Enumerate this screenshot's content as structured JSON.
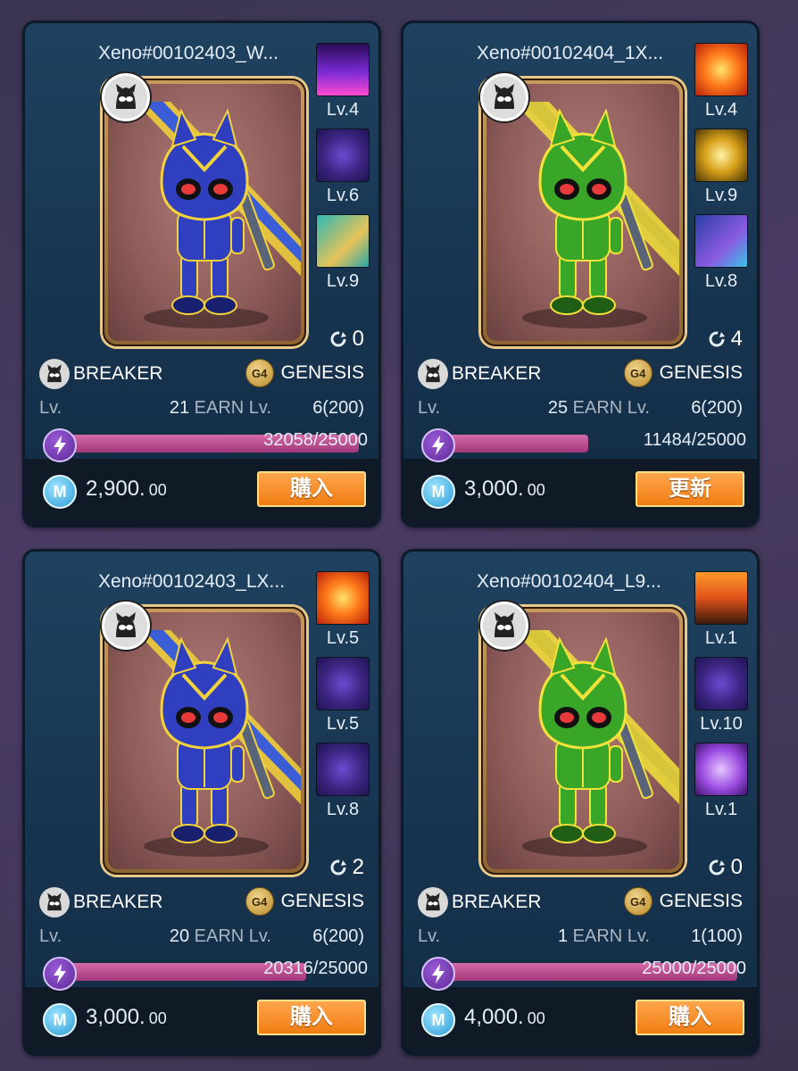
{
  "cards": [
    {
      "name": "Xeno#00102403_W...",
      "skills": [
        {
          "lv": "Lv.4",
          "icon": "neon-orb-skill-icon"
        },
        {
          "lv": "Lv.6",
          "icon": "target-skill-icon"
        },
        {
          "lv": "Lv.9",
          "icon": "boot-skill-icon"
        }
      ],
      "repair": "0",
      "class": "BREAKER",
      "gen_badge": "G4",
      "genesis": "GENESIS",
      "lv_label": "Lv.",
      "lv": "21",
      "earn_label": "EARN Lv.",
      "earn": "6(200)",
      "energy": "32058/25000",
      "energy_fraction": 1.0,
      "coin": "M",
      "price": "2,900.",
      "price_dec": "00",
      "button": "購入",
      "color": "blue"
    },
    {
      "name": "Xeno#00102404_1X...",
      "skills": [
        {
          "lv": "Lv.4",
          "icon": "fire-skill-icon"
        },
        {
          "lv": "Lv.9",
          "icon": "star-burst-skill-icon"
        },
        {
          "lv": "Lv.8",
          "icon": "shield-skill-icon"
        }
      ],
      "repair": "4",
      "class": "BREAKER",
      "gen_badge": "G4",
      "genesis": "GENESIS",
      "lv_label": "Lv.",
      "lv": "25",
      "earn_label": "EARN Lv.",
      "earn": "6(200)",
      "energy": "11484/25000",
      "energy_fraction": 0.46,
      "coin": "M",
      "price": "3,000.",
      "price_dec": "00",
      "button": "更新",
      "color": "green"
    },
    {
      "name": "Xeno#00102403_LX...",
      "skills": [
        {
          "lv": "Lv.5",
          "icon": "fire-skill-icon"
        },
        {
          "lv": "Lv.5",
          "icon": "target-skill-icon"
        },
        {
          "lv": "Lv.8",
          "icon": "target-skill-icon"
        }
      ],
      "repair": "2",
      "class": "BREAKER",
      "gen_badge": "G4",
      "genesis": "GENESIS",
      "lv_label": "Lv.",
      "lv": "20",
      "earn_label": "EARN Lv.",
      "earn": "6(200)",
      "energy": "20316/25000",
      "energy_fraction": 0.81,
      "coin": "M",
      "price": "3,000.",
      "price_dec": "00",
      "button": "購入",
      "color": "blue"
    },
    {
      "name": "Xeno#00102404_L9...",
      "skills": [
        {
          "lv": "Lv.1",
          "icon": "flame-warrior-skill-icon"
        },
        {
          "lv": "Lv.10",
          "icon": "target-skill-icon"
        },
        {
          "lv": "Lv.1",
          "icon": "ghost-skill-icon"
        }
      ],
      "repair": "0",
      "class": "BREAKER",
      "gen_badge": "G4",
      "genesis": "GENESIS",
      "lv_label": "Lv.",
      "lv": "1",
      "earn_label": "EARN Lv.",
      "earn": "1(100)",
      "energy": "25000/25000",
      "energy_fraction": 1.0,
      "coin": "M",
      "price": "4,000.",
      "price_dec": "00",
      "button": "購入",
      "color": "green"
    }
  ]
}
